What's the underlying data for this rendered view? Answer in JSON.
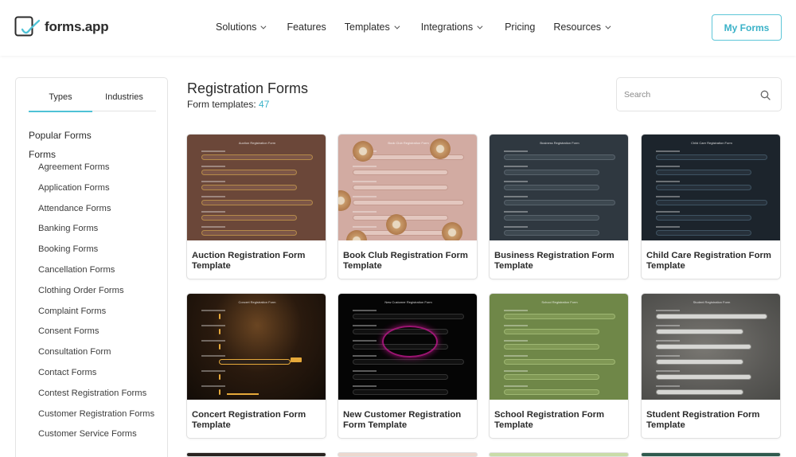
{
  "header": {
    "logo_text": "forms.app",
    "nav": [
      {
        "label": "Solutions",
        "dropdown": true
      },
      {
        "label": "Features",
        "dropdown": false
      },
      {
        "label": "Templates",
        "dropdown": true
      },
      {
        "label": "Integrations",
        "dropdown": true
      },
      {
        "label": "Pricing",
        "dropdown": false
      },
      {
        "label": "Resources",
        "dropdown": true
      }
    ],
    "my_forms_label": "My Forms"
  },
  "sidebar": {
    "tabs": [
      "Types",
      "Industries"
    ],
    "active_tab": "Types",
    "popular_label": "Popular Forms",
    "forms_label": "Forms",
    "items": [
      "Agreement Forms",
      "Application Forms",
      "Attendance Forms",
      "Banking Forms",
      "Booking Forms",
      "Cancellation Forms",
      "Clothing Order Forms",
      "Complaint Forms",
      "Consent Forms",
      "Consultation Form",
      "Contact Forms",
      "Contest Registration Forms",
      "Customer Registration Forms",
      "Customer Service Forms"
    ]
  },
  "main": {
    "title": "Registration Forms",
    "count_label": "Form templates:",
    "count_value": "47",
    "search_placeholder": "Search",
    "cards": [
      {
        "title": "Auction Registration Form Template",
        "thumb_title": "Auction Registration Form",
        "bg": "#6b4739",
        "field": "#7d5647",
        "border": "#b58a4a",
        "style": "outline"
      },
      {
        "title": "Book Club Registration Form Template",
        "thumb_title": "Book Club Registration Form",
        "bg": "#d2aba2",
        "field": "#e3c7bf",
        "border": "#c49a8f",
        "style": "donut"
      },
      {
        "title": "Business Registration Form Template",
        "thumb_title": "Business Registration Form",
        "bg": "#2f3840",
        "field": "#3d4850",
        "border": "#58636c",
        "style": "plain"
      },
      {
        "title": "Child Care Registration Form Template",
        "thumb_title": "Child Care Registration Form",
        "bg": "#1c242c",
        "field": "#26303a",
        "border": "#3f5362",
        "style": "plain"
      },
      {
        "title": "Concert Registration Form Template",
        "thumb_title": "Concert Registration Form",
        "bg": "#1c140d",
        "field": "#2a2019",
        "border": "#e6a93a",
        "style": "concert"
      },
      {
        "title": "New Customer Registration Form Template",
        "thumb_title": "New Customer Registration Form",
        "bg": "#050505",
        "field": "#111111",
        "border": "#333333",
        "style": "neon"
      },
      {
        "title": "School Registration Form Template",
        "thumb_title": "School Registration Form",
        "bg": "#6f8748",
        "field": "#809855",
        "border": "#9fb873",
        "style": "plain"
      },
      {
        "title": "Student Registration Form Template",
        "thumb_title": "Student Registration Form",
        "bg": "#5b5b58",
        "field": "#d6d6d3",
        "border": "#8a8a86",
        "style": "student"
      }
    ],
    "next_row_colors": [
      "#2a2421",
      "#ecd8cf",
      "#c9dca8",
      "#2f5a4e"
    ]
  }
}
